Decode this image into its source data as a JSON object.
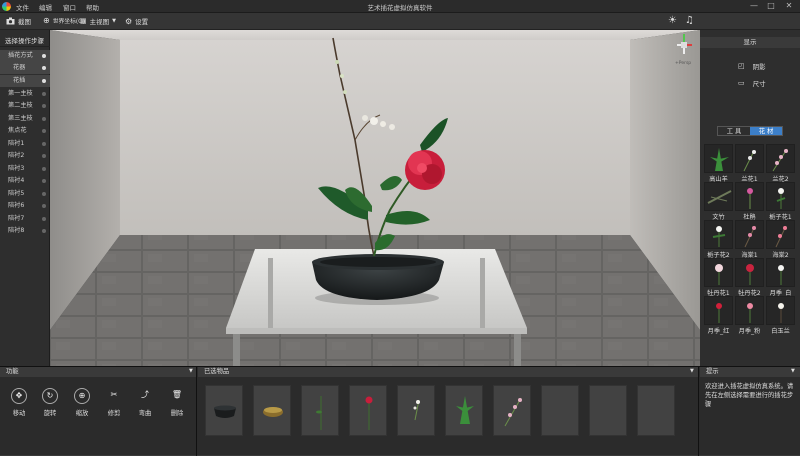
{
  "app": {
    "title": "艺术插花虚拟仿真软件"
  },
  "menu": [
    "文件",
    "编辑",
    "窗口",
    "帮助"
  ],
  "window_controls": [
    "—",
    "□",
    "✕"
  ],
  "toolbar": {
    "screenshot": "截图",
    "coord": "世界坐标(G)",
    "view": "主视图",
    "settings": "设置"
  },
  "steps": {
    "header": "选择操作步骤",
    "items": [
      "插花方式",
      "花器",
      "花插",
      "第一主枝",
      "第二主枝",
      "第三主枝",
      "焦点花",
      "陪衬1",
      "陪衬2",
      "陪衬3",
      "陪衬4",
      "陪衬5",
      "陪衬6",
      "陪衬7",
      "陪衬8"
    ]
  },
  "gizmo": {
    "label": "+Persp"
  },
  "display": {
    "header": "显示",
    "shadow": "阴影",
    "size": "尺寸"
  },
  "tabs": {
    "tools": "工 具",
    "materials": "花 材"
  },
  "materials": [
    "高山羊",
    "兰花1",
    "兰花2",
    "文竹",
    "杜鹃",
    "栀子花1",
    "栀子花2",
    "海棠1",
    "海棠2",
    "牡丹花1",
    "牡丹花2",
    "月季_白",
    "月季_红",
    "月季_粉",
    "白玉兰"
  ],
  "functions": {
    "header": "功能",
    "buttons": [
      "移动",
      "旋转",
      "缩放",
      "修剪",
      "弯曲",
      "删除"
    ]
  },
  "selected": {
    "header": "已选物品"
  },
  "hint": {
    "header": "提示",
    "text": "欢迎进入插花虚拟仿真系统。请先在左侧选择需要进行的插花步骤"
  }
}
